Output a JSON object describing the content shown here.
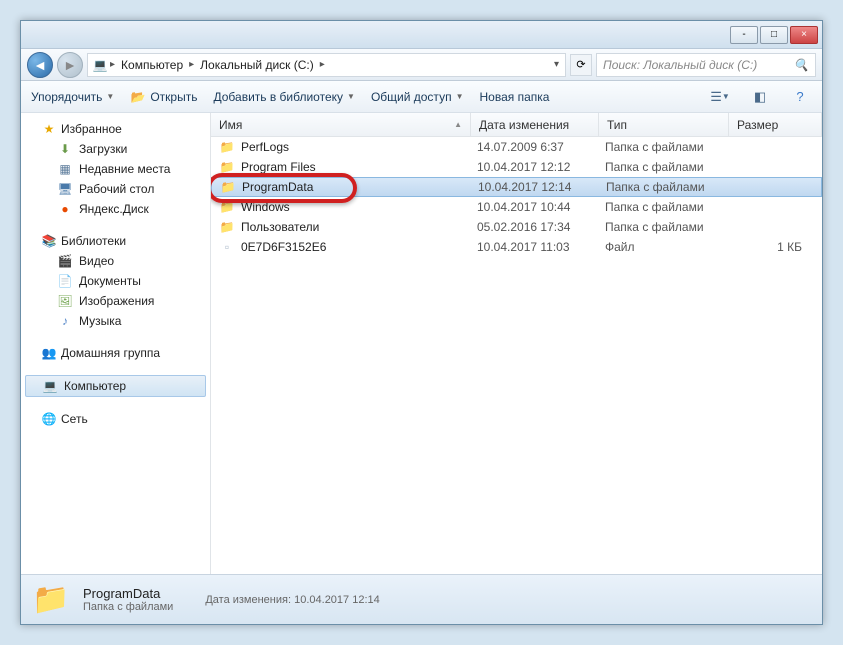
{
  "titlebar": {
    "minimize": "-",
    "maximize": "□",
    "close": "×"
  },
  "nav": {
    "back": "◄",
    "forward": "►",
    "refresh": "⟳"
  },
  "breadcrumb": {
    "root": "Компьютер",
    "drive": "Локальный диск (C:)"
  },
  "search": {
    "placeholder": "Поиск: Локальный диск (C:)"
  },
  "toolbar": {
    "organize": "Упорядочить",
    "open": "Открыть",
    "library": "Добавить в библиотеку",
    "share": "Общий доступ",
    "newfolder": "Новая папка"
  },
  "sidebar": {
    "favorites": {
      "label": "Избранное"
    },
    "downloads": {
      "label": "Загрузки"
    },
    "recent": {
      "label": "Недавние места"
    },
    "desktop": {
      "label": "Рабочий стол"
    },
    "ydisk": {
      "label": "Яндекс.Диск"
    },
    "libraries": {
      "label": "Библиотеки"
    },
    "video": {
      "label": "Видео"
    },
    "documents": {
      "label": "Документы"
    },
    "images": {
      "label": "Изображения"
    },
    "music": {
      "label": "Музыка"
    },
    "homegroup": {
      "label": "Домашняя группа"
    },
    "computer": {
      "label": "Компьютер"
    },
    "network": {
      "label": "Сеть"
    }
  },
  "columns": {
    "name": "Имя",
    "date": "Дата изменения",
    "type": "Тип",
    "size": "Размер"
  },
  "files": [
    {
      "name": "PerfLogs",
      "date": "14.07.2009 6:37",
      "type": "Папка с файлами",
      "size": "",
      "icon": "folder"
    },
    {
      "name": "Program Files",
      "date": "10.04.2017 12:12",
      "type": "Папка с файлами",
      "size": "",
      "icon": "folder"
    },
    {
      "name": "ProgramData",
      "date": "10.04.2017 12:14",
      "type": "Папка с файлами",
      "size": "",
      "icon": "folder",
      "selected": true
    },
    {
      "name": "Windows",
      "date": "10.04.2017 10:44",
      "type": "Папка с файлами",
      "size": "",
      "icon": "folder"
    },
    {
      "name": "Пользователи",
      "date": "05.02.2016 17:34",
      "type": "Папка с файлами",
      "size": "",
      "icon": "folder"
    },
    {
      "name": "0E7D6F3152E6",
      "date": "10.04.2017 11:03",
      "type": "Файл",
      "size": "1 КБ",
      "icon": "file"
    }
  ],
  "status": {
    "name": "ProgramData",
    "type": "Папка с файлами",
    "meta_label": "Дата изменения:",
    "meta_value": "10.04.2017 12:14"
  }
}
